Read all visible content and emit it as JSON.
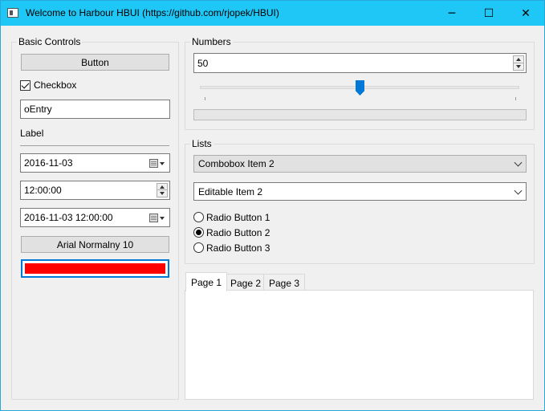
{
  "window": {
    "title": "Welcome to Harbour HBUI (https://github.com/rjopek/HBUI)",
    "minimize_glyph": "─",
    "maximize_glyph": "☐",
    "close_glyph": "✕"
  },
  "basic": {
    "group_label": "Basic Controls",
    "button_label": "Button",
    "checkbox_label": "Checkbox",
    "checkbox_checked": true,
    "entry_value": "oEntry",
    "label_text": "Label",
    "date_value": "2016-11-03",
    "time_value": "12:00:00",
    "datetime_value": "2016-11-03 12:00:00",
    "font_button_label": "Arial Normalny 10",
    "color_value": "#ff0000"
  },
  "numbers": {
    "group_label": "Numbers",
    "spinbox_value": "50",
    "slider_value": 50,
    "slider_min": 0,
    "slider_max": 100,
    "progress_value": 0
  },
  "lists": {
    "group_label": "Lists",
    "combobox_value": "Combobox Item 2",
    "editable_value": "Editable Item 2",
    "radios": [
      {
        "label": "Radio Button 1",
        "selected": false
      },
      {
        "label": "Radio Button 2",
        "selected": true
      },
      {
        "label": "Radio Button 3",
        "selected": false
      }
    ]
  },
  "tabs": [
    "Page 1",
    "Page 2",
    "Page 3"
  ],
  "colors": {
    "titlebar": "#1ec7f6",
    "accent": "#0078d7",
    "color_swatch": "#ff0000"
  }
}
